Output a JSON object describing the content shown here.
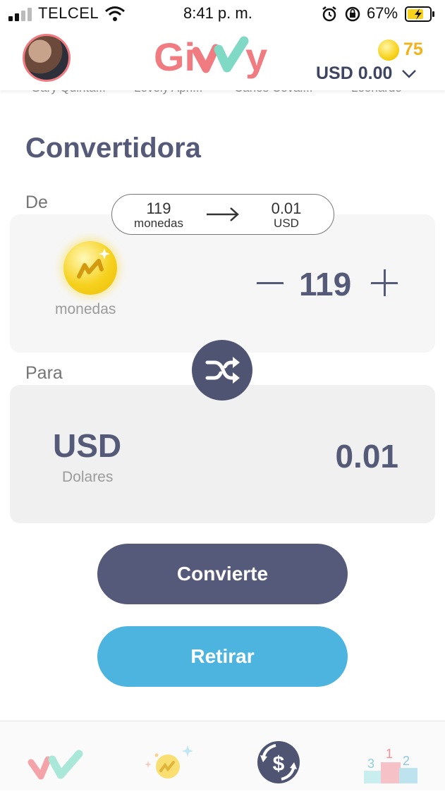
{
  "status_bar": {
    "carrier": "TELCEL",
    "time": "8:41 p. m.",
    "battery_percent": "67%",
    "icons": [
      "signal-icon",
      "wifi-icon",
      "alarm-icon",
      "orientation-lock-icon",
      "battery-charging-icon"
    ]
  },
  "header": {
    "logo_text": "Givvy",
    "coin_count": "75",
    "balance": "USD 0.00",
    "colors": {
      "logo_pink": "#f07b80",
      "logo_mint": "#7fd9c4",
      "coin_gold": "#f3b21a"
    }
  },
  "friends": [
    "Gary Quinta...",
    "Lovely Apri...",
    "Carlos Ceval...",
    "Leonardo"
  ],
  "converter": {
    "title": "Convertidora",
    "from_label": "De",
    "to_label": "Para",
    "rate": {
      "from_value": "119",
      "from_unit": "monedas",
      "to_value": "0.01",
      "to_unit": "USD"
    },
    "from": {
      "unit_label": "monedas",
      "quantity": "119"
    },
    "to": {
      "code": "USD",
      "name": "Dolares",
      "amount": "0.01"
    }
  },
  "buttons": {
    "convert": "Convierte",
    "withdraw": "Retirar"
  },
  "colors": {
    "primary_dark": "#565a7a",
    "primary_blue": "#4db4e0"
  },
  "tabbar": {
    "items": [
      "home-tab-icon",
      "coins-tab-icon",
      "convert-tab-icon",
      "leaderboard-tab-icon"
    ],
    "active": "convert-tab-icon"
  }
}
